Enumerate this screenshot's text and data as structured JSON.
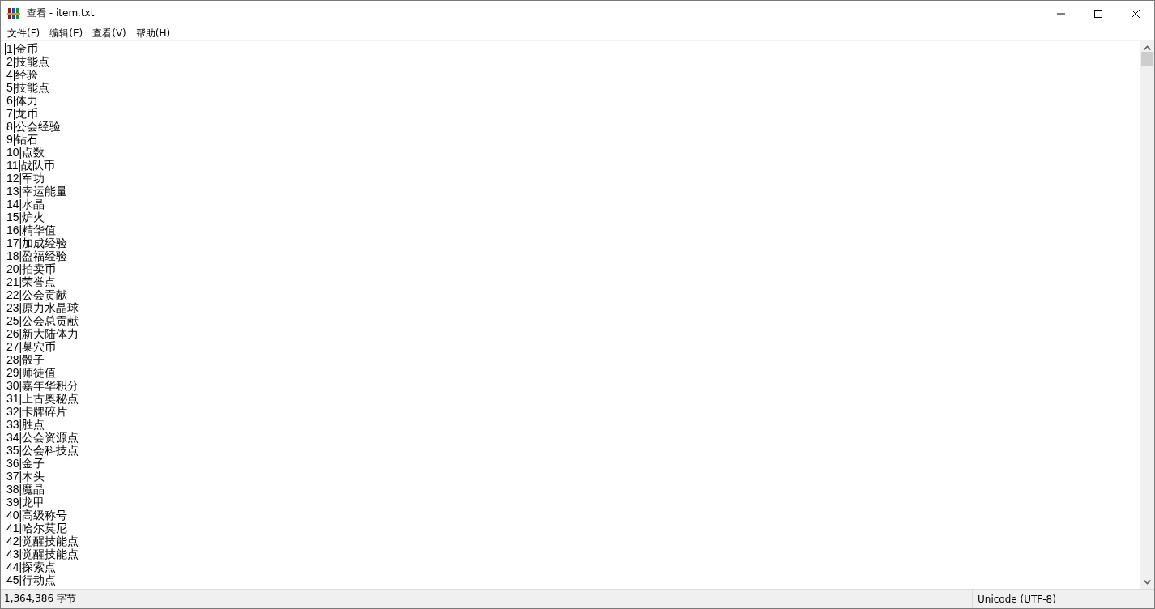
{
  "window": {
    "title": "查看 - item.txt"
  },
  "menu": [
    {
      "label": "文件(F)"
    },
    {
      "label": "编辑(E)"
    },
    {
      "label": "查看(V)"
    },
    {
      "label": "帮助(H)"
    }
  ],
  "lines": [
    "1|金币",
    "2|技能点",
    "4|经验",
    "5|技能点",
    "6|体力",
    "7|龙币",
    "8|公会经验",
    "9|钻石",
    "10|点数",
    "11|战队币",
    "12|军功",
    "13|幸运能量",
    "14|水晶",
    "15|炉火",
    "16|精华值",
    "17|加成经验",
    "18|盈福经验",
    "20|拍卖币",
    "21|荣誉点",
    "22|公会贡献",
    "23|原力水晶球",
    "25|公会总贡献",
    "26|新大陆体力",
    "27|巢穴币",
    "28|骰子",
    "29|师徒值",
    "30|嘉年华积分",
    "31|上古奥秘点",
    "32|卡牌碎片",
    "33|胜点",
    "34|公会资源点",
    "35|公会科技点",
    "36|金子",
    "37|木头",
    "38|魔晶",
    "39|龙甲",
    "40|高级称号",
    "41|哈尔莫尼",
    "42|觉醒技能点",
    "43|觉醒技能点",
    "44|探索点",
    "45|行动点"
  ],
  "status_bar": {
    "size": "1,364,386 字节",
    "encoding": "Unicode (UTF-8)"
  }
}
